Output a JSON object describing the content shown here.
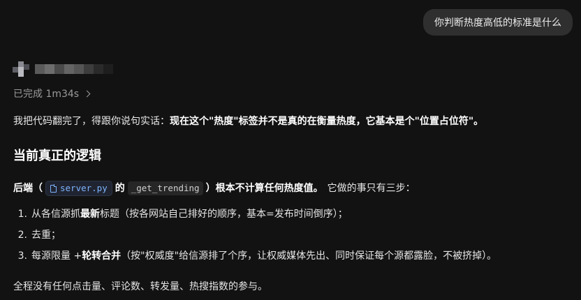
{
  "user_message": "你判断热度高低的标准是什么",
  "status": {
    "label": "已完成 1m34s"
  },
  "intro": {
    "plain": "我把代码翻完了，得跟你说句实话：",
    "bold": "现在这个\"热度\"标签并不是真的在衡量热度，它基本是个\"位置占位符\"。"
  },
  "heading": "当前真正的逻辑",
  "backend": {
    "bold_prefix": "后端（",
    "file_name": "server.py",
    "bold_mid": "的",
    "function_name": "_get_trending",
    "bold_suffix": "）根本不计算任何热度值。",
    "plain": "它做的事只有三步："
  },
  "steps": [
    {
      "num": "1.",
      "before": "从各信源抓",
      "bold": "最新",
      "after": "标题（按各网站自己排好的顺序，基本=发布时间倒序）；"
    },
    {
      "num": "2.",
      "before": "去重；",
      "bold": "",
      "after": ""
    },
    {
      "num": "3.",
      "before": "每源限量 + ",
      "bold": "轮转合并",
      "after": "（按\"权威度\"给信源排了个序，让权威媒体先出、同时保证每个源都露脸，不被挤掉）。"
    }
  ],
  "footer": "全程没有任何点击量、评论数、转发量、热搜指数的参与。",
  "icons": {
    "file": "file-icon",
    "chevron": "chevron-right-icon"
  }
}
